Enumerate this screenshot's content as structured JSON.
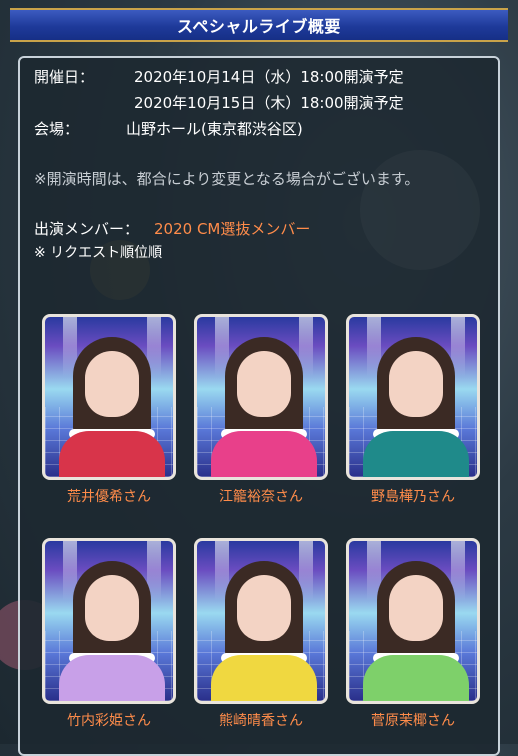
{
  "header": {
    "title": "スペシャルライブ概要"
  },
  "info": {
    "date_label": "開催日：",
    "date1": "2020年10月14日（水）18:00開演予定",
    "date2": "2020年10月15日（木）18:00開演予定",
    "venue_label": "会場：",
    "venue": "山野ホール(東京都渋谷区)",
    "notice": "※開演時間は、都合により変更となる場合がございます。",
    "members_label": "出演メンバー：",
    "members_value": "2020 CM選抜メンバー",
    "order_note": "※ リクエスト順位順"
  },
  "members": [
    {
      "name": "荒井優希さん",
      "outfit_color": "#d8344a"
    },
    {
      "name": "江籠裕奈さん",
      "outfit_color": "#e8408a"
    },
    {
      "name": "野島樺乃さん",
      "outfit_color": "#1f8a8a"
    },
    {
      "name": "竹内彩姫さん",
      "outfit_color": "#c8a0e8"
    },
    {
      "name": "熊崎晴香さん",
      "outfit_color": "#f0d840"
    },
    {
      "name": "菅原茉椰さん",
      "outfit_color": "#7ed06a"
    }
  ],
  "colors": {
    "accent": "#ff8c4a",
    "header_blue": "#1e3a9a",
    "header_border": "#c9a34a"
  }
}
